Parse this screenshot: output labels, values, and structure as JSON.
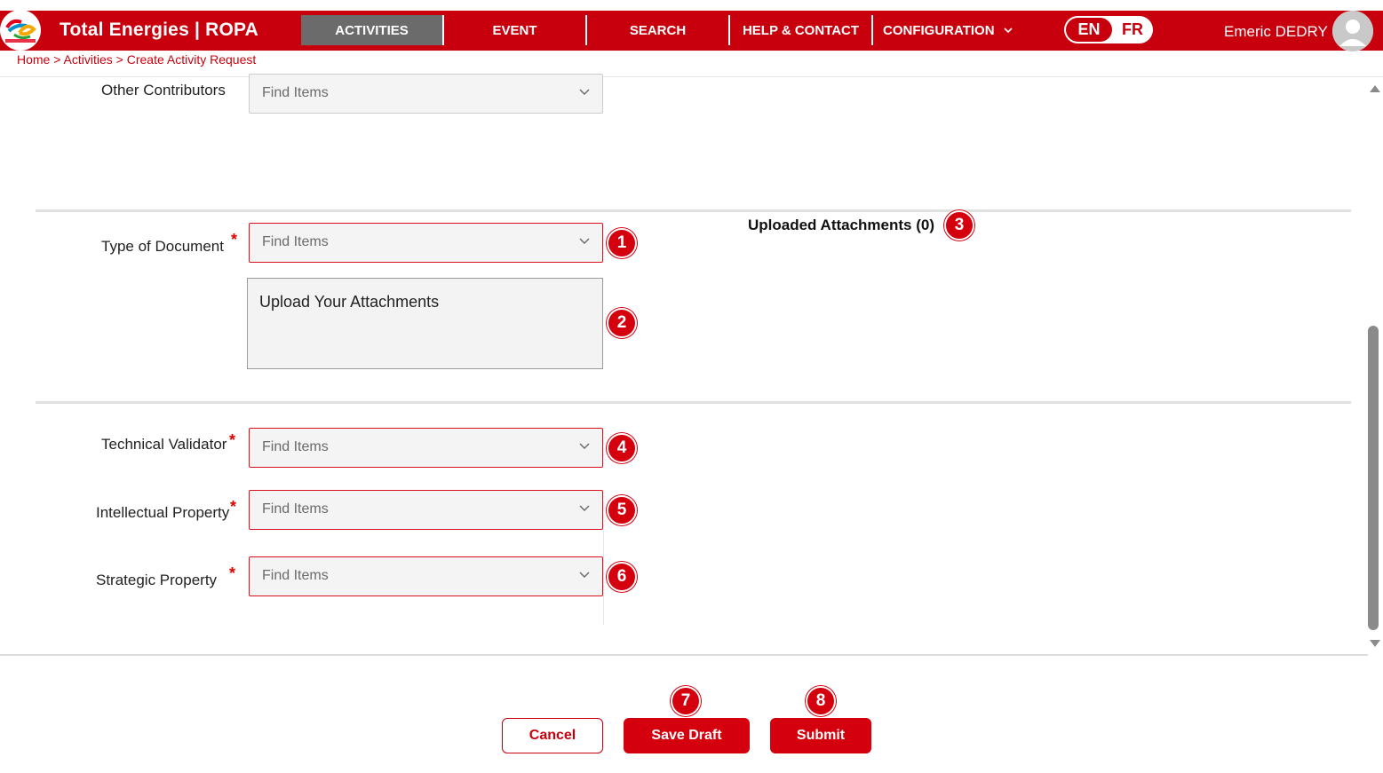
{
  "header": {
    "brand": "Total Energies | ROPA",
    "nav": [
      {
        "label": "ACTIVITIES",
        "active": true
      },
      {
        "label": "EVENT",
        "active": false
      },
      {
        "label": "SEARCH",
        "active": false
      },
      {
        "label": "HELP & CONTACT",
        "active": false
      },
      {
        "label": "CONFIGURATION",
        "active": false
      }
    ],
    "lang": {
      "en": "EN",
      "fr": "FR",
      "selected": "EN"
    },
    "user": "Emeric DEDRY"
  },
  "breadcrumb": {
    "home": "Home",
    "sep1": " > ",
    "activities": "Activities",
    "sep2": " > ",
    "current": "Create Activity Request"
  },
  "form": {
    "other_contributors": {
      "label": "Other Contributors",
      "placeholder": "Find Items"
    },
    "type_of_document": {
      "label": "Type of Document",
      "placeholder": "Find Items",
      "required_mark": "*"
    },
    "upload": {
      "label": "Upload Your Attachments"
    },
    "uploaded_attachments": {
      "title": "Uploaded Attachments (0)"
    },
    "technical_validator": {
      "label": "Technical Validator",
      "placeholder": "Find Items",
      "required_mark": "*"
    },
    "intellectual_property": {
      "label": "Intellectual Property",
      "placeholder": "Find Items",
      "required_mark": "*"
    },
    "strategic_property": {
      "label": "Strategic Property",
      "placeholder": "Find Items",
      "required_mark": "*"
    }
  },
  "badges": {
    "b1": "1",
    "b2": "2",
    "b3": "3",
    "b4": "4",
    "b5": "5",
    "b6": "6",
    "b7": "7",
    "b8": "8"
  },
  "buttons": {
    "cancel": "Cancel",
    "save_draft": "Save Draft",
    "submit": "Submit"
  },
  "colors": {
    "brand_red": "#c8000d",
    "active_nav": "#6b6b6b",
    "badge_red": "#d4000e"
  }
}
